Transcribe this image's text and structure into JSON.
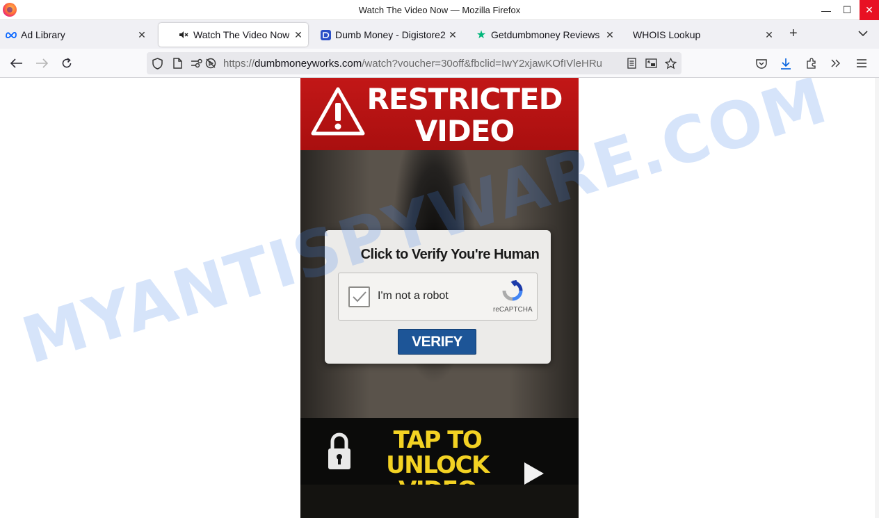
{
  "window": {
    "title": "Watch The Video Now — Mozilla Firefox",
    "controls": {
      "minimize": "—",
      "maximize": "☐",
      "close": "✕"
    }
  },
  "tabs": [
    {
      "label": "Ad Library",
      "icon": "meta-icon",
      "active": false
    },
    {
      "label": "Watch The Video Now",
      "icon": "muted-speaker-icon",
      "active": true
    },
    {
      "label": "Dumb Money - Digistore2",
      "icon": "digistore-icon",
      "active": false
    },
    {
      "label": "Getdumbmoney Reviews",
      "icon": "trustpilot-star-icon",
      "active": false
    },
    {
      "label": "WHOIS Lookup",
      "icon": "none",
      "active": false
    }
  ],
  "urlbar": {
    "prefix": "https://",
    "host": "dumbmoneyworks.com",
    "path": "/watch?voucher=30off&fbclid=IwY2xjawKOfIVleHRu"
  },
  "page": {
    "banner": {
      "line1": "RESTRICTED",
      "line2": "VIDEO"
    },
    "captcha": {
      "title": "Click to Verify You're Human",
      "checkbox_label": "I'm not a robot",
      "recaptcha_text": "reCAPTCHA",
      "verify_button": "VERIFY"
    },
    "unlock": {
      "line1": "TAP TO UNLOCK",
      "line2": "VIDEO"
    }
  },
  "watermark": "MYANTISPYWARE.COM",
  "colors": {
    "banner_red": "#c21717",
    "verify_blue": "#1d5597",
    "unlock_yellow": "#f3d223",
    "watermark_blue": "#4682e6"
  }
}
